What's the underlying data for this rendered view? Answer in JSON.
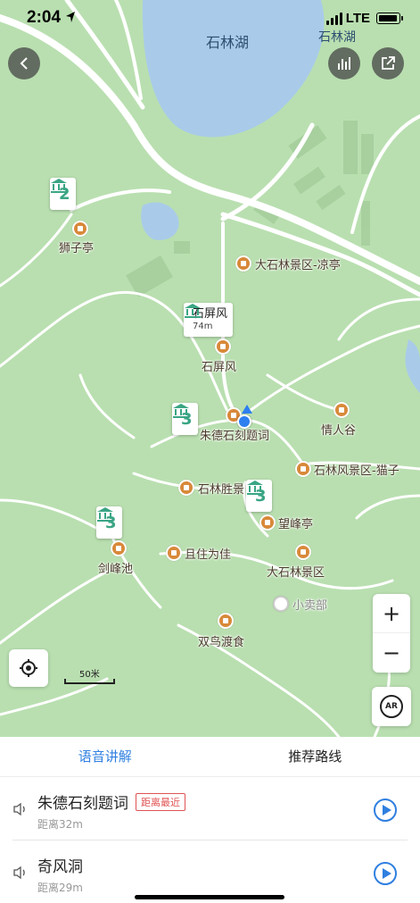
{
  "status_bar": {
    "time": "2:04",
    "network": "LTE"
  },
  "map": {
    "lake_label_1": "石林湖",
    "lake_label_2": "石林湖",
    "poi_labels": {
      "shizi_ting": "狮子亭",
      "da_shilin_liangting": "大石林景区-凉亭",
      "shi_pingfeng": "石屏风",
      "qingren_gu": "情人谷",
      "zhude_keti": "朱德石刻题词",
      "shilin_maozi": "石林风景区-猫子",
      "shilin_shengjing": "石林胜景",
      "wangfeng_ting": "望峰亭",
      "jianfeng_chi": "剑峰池",
      "qie_zhu_wei_jia": "且住为佳",
      "da_shilin_jingqu": "大石林景区",
      "xiaomaibu": "小卖部",
      "shuangniao_dushi": "双鸟渡食"
    },
    "clusters": {
      "c1": "2",
      "c2": "3",
      "c3": "3",
      "c4": "3"
    },
    "highlight_marker": {
      "name": "石屏风",
      "distance": "74m"
    },
    "scale_label": "50米",
    "zoom_in": "+",
    "zoom_out": "−",
    "ar_label": "AR"
  },
  "sheet": {
    "tabs": [
      {
        "label": "语音讲解",
        "active": true
      },
      {
        "label": "推荐路线",
        "active": false
      }
    ],
    "items": [
      {
        "title": "朱德石刻题词",
        "badge": "距离最近",
        "distance": "距离32m"
      },
      {
        "title": "奇风洞",
        "badge": "",
        "distance": "距离29m"
      }
    ]
  },
  "colors": {
    "accent": "#2f7fe0",
    "map_green": "#b9dfb0",
    "water": "#a9cbe9",
    "poi": "#d8893a",
    "cluster_green": "#3aa584"
  }
}
